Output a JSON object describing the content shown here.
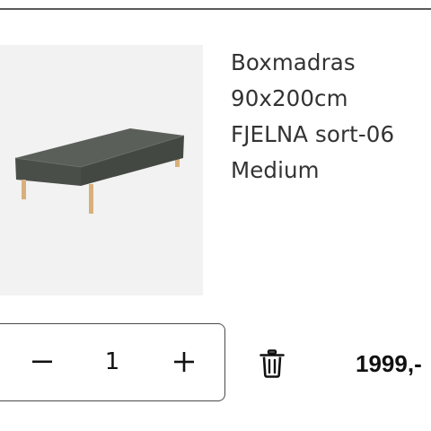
{
  "product": {
    "name_line1": "Boxmadras",
    "name_line2": "90x200cm",
    "variant": "FJELNA sort-06",
    "firmness": "Medium",
    "image_icon": "boxmattress-product-image"
  },
  "quantity": {
    "decrement_icon": "minus-icon",
    "value": "1",
    "increment_icon": "plus-icon"
  },
  "actions": {
    "delete_icon": "trash-icon"
  },
  "price": "1999,-",
  "colors": {
    "mattress": "#4f534e",
    "legs": "#d9b07a",
    "image_bg": "#f2f2f2",
    "text": "#333333"
  }
}
